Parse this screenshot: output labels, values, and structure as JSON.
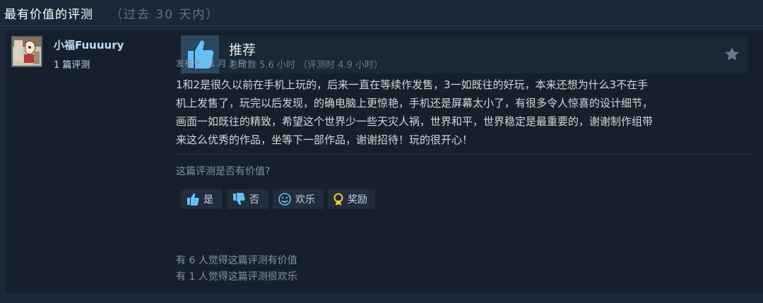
{
  "header": {
    "title": "最有价值的评测",
    "subtitle": "（过去 30 天内）"
  },
  "author": {
    "name": "小福Fuuuury",
    "review_count": "1 篇评测"
  },
  "verdict": {
    "label": "推荐",
    "hours": "总时数 5.6 小时 （评测时 4.9 小时）"
  },
  "review": {
    "posted": "发布于：1 月 3 日",
    "lines": [
      "1和2是很久以前在手机上玩的，后来一直在等续作发售，3一如既往的好玩，本来还想为什么3不在手",
      "机上发售了，玩完以后发现，的确电脑上更惊艳，手机还是屏幕太小了，有很多令人惊喜的设计细节，",
      "画面一如既往的精致，希望这个世界少一些天灾人祸，世界和平，世界稳定是最重要的，谢谢制作组带",
      "来这么优秀的作品，坐等下一部作品，谢谢招待！玩的很开心！"
    ]
  },
  "helpful": {
    "question": "这篇评测是否有价值?",
    "buttons": {
      "yes": "是",
      "no": "否",
      "funny": "欢乐",
      "award": "奖励"
    },
    "stats": [
      "有 6 人觉得这篇评测有价值",
      "有 1 人觉得这篇评测很欢乐"
    ]
  },
  "colors": {
    "background": "#1b2838",
    "card": "#16202d",
    "accent": "#66c0f4",
    "thumb_box": "#2b4761"
  },
  "icons": {
    "thumb": "thumbs-up-icon",
    "star": "star-icon",
    "vote_yes": "thumbs-up-icon",
    "vote_no": "thumbs-down-icon",
    "funny": "smiley-icon",
    "award": "award-ribbon-icon"
  }
}
